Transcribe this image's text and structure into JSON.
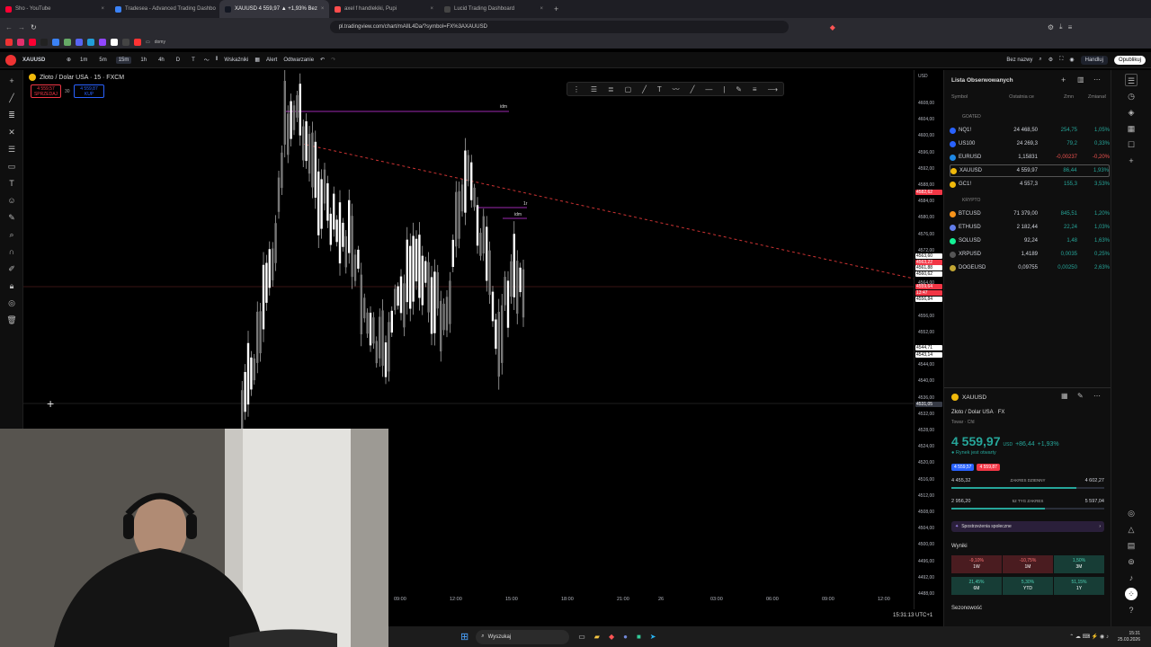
{
  "browser": {
    "tabs": [
      {
        "label": "Sho - YouTube",
        "color": "#ff0033"
      },
      {
        "label": "Tradesea - Advanced Trading Dashbo",
        "color": "#3b82f6"
      },
      {
        "label": "XAUUSD 4 559,97 ▲ +1,93% Bez",
        "color": "#131722",
        "active": true
      },
      {
        "label": "axel f handlekiki, Pupi",
        "color": "#ff4d4d"
      },
      {
        "label": "Lucid Trading Dashboard",
        "color": "#444"
      }
    ],
    "url": "pl.tradingview.com/chart/mAlIL4Da/?symbol=FX%3AXAUUSD",
    "bookmark_folder": "domy"
  },
  "toolbar": {
    "symbol": "XAUUSD",
    "timeframes": [
      "1m",
      "5m",
      "15m",
      "1h",
      "4h",
      "D",
      "T"
    ],
    "active_timeframe": "15m",
    "indicators_label": "Wskaźniki",
    "alert_label": "Alert",
    "replay_label": "Odtwarzanie",
    "layout_name": "Bez nazwy",
    "trade_label": "Handluj",
    "publish_label": "Opublikuj"
  },
  "chart": {
    "legend_title": "Złoto / Dolar USA · 15 · FXCM",
    "sell_price": "4 559,57",
    "sell_label": "SPRZEDAJ",
    "spread": "30",
    "buy_price": "4 559,87",
    "buy_label": "KUP",
    "currency": "USD",
    "annotations": [
      "idm",
      "1r",
      "idm"
    ],
    "price_ticks": [
      "4608,00",
      "4604,00",
      "4600,00",
      "4596,00",
      "4592,00",
      "4588,00",
      "4584,00",
      "4580,00",
      "4576,00",
      "4572,00",
      "4568,00",
      "4564,00",
      "4560,00",
      "4556,00",
      "4552,00",
      "4548,00",
      "4544,00",
      "4540,00",
      "4536,00",
      "4532,00",
      "4528,00",
      "4524,00",
      "4520,00",
      "4516,00",
      "4512,00",
      "4508,00",
      "4504,00",
      "4500,00",
      "4496,00",
      "4492,00",
      "4488,00"
    ],
    "price_labels": [
      {
        "text": "4582,62",
        "color": "#f23645"
      },
      {
        "text": "4563,60",
        "color": "#ffffff"
      },
      {
        "text": "4563,22",
        "color": "#f23645"
      },
      {
        "text": "4561,88",
        "color": "#ffffff"
      },
      {
        "text": "4560,62",
        "color": "#ffffff"
      },
      {
        "text": "4559,64",
        "color": "#f23645"
      },
      {
        "text": "13:47",
        "color": "#f23645"
      },
      {
        "text": "4556,84",
        "color": "#ffffff"
      },
      {
        "text": "4544,71",
        "color": "#ffffff"
      },
      {
        "text": "4543,14",
        "color": "#ffffff"
      },
      {
        "text": "4531,05",
        "color": "#363a45"
      }
    ],
    "time_ticks": [
      "09:00",
      "12:00",
      "15:00",
      "18:00",
      "21:00",
      "26",
      "03:00",
      "06:00",
      "09:00",
      "12:00"
    ],
    "clock": "15:31:13 UTC+1"
  },
  "watchlist": {
    "title": "Lista Obserwowanych",
    "col_symbol": "Symbol",
    "col_last": "Ostatnia ce",
    "col_change": "Zmn",
    "col_change_pct": "Zmianaℓ",
    "section_1": "GOATED",
    "section_2": "KRYPTO",
    "rows": [
      {
        "symbol": "NQ1!",
        "last": "24 468,50",
        "chg": "254,75",
        "pct": "1,05%",
        "dir": "up",
        "color": "#2962ff"
      },
      {
        "symbol": "US100",
        "last": "24 269,3",
        "chg": "79,2",
        "pct": "0,33%",
        "dir": "up",
        "color": "#2962ff"
      },
      {
        "symbol": "EURUSD",
        "last": "1,15831",
        "chg": "-0,00237",
        "pct": "-0,20%",
        "dir": "dn",
        "color": "#1e88e5"
      },
      {
        "symbol": "XAUUSD",
        "last": "4 559,97",
        "chg": "86,44",
        "pct": "1,93%",
        "dir": "up",
        "color": "#f0b90b"
      },
      {
        "symbol": "GC1!",
        "last": "4 557,3",
        "chg": "155,3",
        "pct": "3,53%",
        "dir": "up",
        "color": "#f0b90b"
      },
      {
        "symbol": "BTCUSD",
        "last": "71 379,00",
        "chg": "845,51",
        "pct": "1,20%",
        "dir": "up",
        "color": "#f7931a"
      },
      {
        "symbol": "ETHUSD",
        "last": "2 182,44",
        "chg": "22,24",
        "pct": "1,03%",
        "dir": "up",
        "color": "#627eea"
      },
      {
        "symbol": "SOLUSD",
        "last": "92,24",
        "chg": "1,48",
        "pct": "1,63%",
        "dir": "up",
        "color": "#14f195"
      },
      {
        "symbol": "XRPUSD",
        "last": "1,4189",
        "chg": "0,0035",
        "pct": "0,25%",
        "dir": "up",
        "color": "#555"
      },
      {
        "symbol": "DOGEUSD",
        "last": "0,09755",
        "chg": "0,00250",
        "pct": "2,63%",
        "dir": "up",
        "color": "#c2a633"
      }
    ]
  },
  "detail": {
    "symbol": "XAUUSD",
    "name": "Złoto / Dolar USA",
    "exchange": "FX",
    "type": "Towar · Cfd",
    "price": "4 559,97",
    "currency": "USD",
    "change": "+86,44",
    "change_pct": "+1,93%",
    "market_status": "Rynek jest otwarty",
    "bid": "4 559,57",
    "ask": "4 559,87",
    "day_low": "4 455,32",
    "day_range_label": "ZAKRES DZIENNY",
    "day_high": "4 602,27",
    "day_position": 0.82,
    "week_low": "2 956,20",
    "week_range_label": "52 TYG ZAKRES",
    "week_high": "5 597,04",
    "week_position": 0.61,
    "community_label": "Spostrzeżenia społeczne",
    "results_label": "Wyniki",
    "performance": [
      {
        "value": "-9,10%",
        "period": "1W",
        "dir": "dn"
      },
      {
        "value": "-10,75%",
        "period": "1M",
        "dir": "dn"
      },
      {
        "value": "1,50%",
        "period": "3M",
        "dir": "up"
      },
      {
        "value": "21,45%",
        "period": "6M",
        "dir": "up"
      },
      {
        "value": "5,30%",
        "period": "YTD",
        "dir": "up"
      },
      {
        "value": "51,15%",
        "period": "1Y",
        "dir": "up"
      }
    ],
    "seasonality_label": "Sezonowość"
  },
  "taskbar": {
    "search_label": "Wyszukaj",
    "time": "15:31",
    "date": "25.03.2026"
  }
}
